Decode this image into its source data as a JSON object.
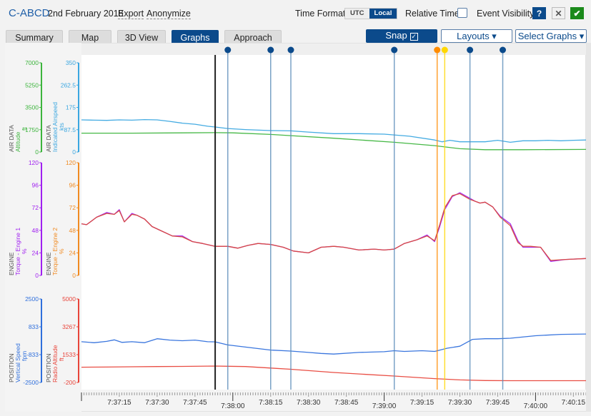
{
  "header": {
    "aircraft": "C-ABCD",
    "date": "2nd February 2018",
    "export_label": "Export",
    "anonymize_label": "Anonymize",
    "time_format_label": "Time Format",
    "time_format_options": [
      "UTC",
      "Local"
    ],
    "time_format_selected": "Local",
    "relative_time_label": "Relative Time",
    "relative_time_checked": false,
    "event_visibility_label": "Event Visibility",
    "help_icon": "?",
    "close_icon": "✕",
    "confirm_icon": "✔"
  },
  "tabs": [
    {
      "label": "Summary",
      "active": false
    },
    {
      "label": "Map",
      "active": false
    },
    {
      "label": "3D View",
      "active": false
    },
    {
      "label": "Graphs",
      "active": true
    },
    {
      "label": "Approach",
      "active": false
    }
  ],
  "toolbar": {
    "snap_label": "Snap",
    "snap_checked": true,
    "layouts_label": "Layouts ▾",
    "select_graphs_label": "Select Graphs ▾"
  },
  "colors": {
    "brand": "#0b4a8b",
    "altitude": "#3cb43c",
    "airspeed": "#3aa6e0",
    "torque1": "#a020f0",
    "torque2": "#f08a20",
    "torque_overlay": "#d94a3a",
    "vertical_speed": "#2f6fdc",
    "radio_altitude": "#e8443a",
    "cursor": "#222222",
    "event_blue": "#5a8bb8",
    "event_orange": "#ff8c00",
    "event_yellow": "#ffd700"
  },
  "chart_data": {
    "type": "line",
    "x_axis": {
      "start": "7:37:05",
      "end": "7:40:25",
      "tick_labels": [
        "7:37:15",
        "7:37:30",
        "7:37:45",
        "7:38:00",
        "7:38:15",
        "7:38:30",
        "7:38:45",
        "7:39:00",
        "7:39:15",
        "7:39:30",
        "7:39:45",
        "7:40:00",
        "7:40:15"
      ],
      "tick_seconds": [
        15,
        30,
        45,
        60,
        75,
        90,
        105,
        120,
        135,
        150,
        165,
        180,
        195
      ]
    },
    "cursor_time_s": 53,
    "events": [
      {
        "time_s": 58,
        "color": "blue"
      },
      {
        "time_s": 75,
        "color": "blue"
      },
      {
        "time_s": 83,
        "color": "blue"
      },
      {
        "time_s": 124,
        "color": "blue"
      },
      {
        "time_s": 141,
        "color": "orange"
      },
      {
        "time_s": 144,
        "color": "yellow"
      },
      {
        "time_s": 154,
        "color": "blue"
      },
      {
        "time_s": 167,
        "color": "blue"
      }
    ],
    "panels": [
      {
        "group": "AIR DATA",
        "axes": [
          {
            "name": "Altitude",
            "unit": "ft",
            "ylim": [
              0,
              7000
            ],
            "ticks": [
              "7000",
              "5250",
              "3500",
              "1750",
              "0"
            ],
            "color_key": "altitude"
          },
          {
            "name": "Indicated Airspeed",
            "unit": "kts",
            "ylim": [
              0,
              350
            ],
            "ticks": [
              "350",
              "262.5",
              "175",
              "87.5",
              "0"
            ],
            "color_key": "airspeed"
          }
        ],
        "series": [
          {
            "name": "Altitude",
            "axis": 0,
            "color_key": "altitude",
            "x": [
              0,
              20,
              40,
              53,
              60,
              75,
              83,
              100,
              124,
              140,
              150,
              160,
              175,
              200
            ],
            "y": [
              1480,
              1480,
              1500,
              1520,
              1500,
              1380,
              1280,
              1080,
              760,
              500,
              260,
              180,
              180,
              200
            ]
          },
          {
            "name": "Indicated Airspeed",
            "axis": 1,
            "color_key": "airspeed",
            "x": [
              0,
              5,
              10,
              15,
              20,
              25,
              30,
              35,
              40,
              45,
              50,
              53,
              58,
              65,
              75,
              83,
              90,
              100,
              110,
              120,
              130,
              140,
              143,
              146,
              150,
              155,
              160,
              165,
              170,
              175,
              180,
              185,
              190,
              195,
              200
            ],
            "y": [
              126,
              125,
              124,
              126,
              125,
              127,
              126,
              120,
              113,
              109,
              101,
              98,
              92,
              88,
              84,
              83,
              78,
              72,
              72,
              70,
              62,
              47,
              40,
              46,
              40,
              40,
              40,
              46,
              38,
              44,
              44,
              46,
              44,
              46,
              47
            ]
          }
        ]
      },
      {
        "group": "ENGINE",
        "axes": [
          {
            "name": "Torque - Engine 1",
            "unit": "%",
            "ylim": [
              0,
              120
            ],
            "ticks": [
              "120",
              "96",
              "72",
              "48",
              "24",
              "0"
            ],
            "color_key": "torque1"
          },
          {
            "name": "Torque - Engine 2",
            "unit": "%",
            "ylim": [
              0,
              120
            ],
            "ticks": [
              "120",
              "96",
              "72",
              "48",
              "24",
              "0"
            ],
            "color_key": "torque2"
          }
        ],
        "series": [
          {
            "name": "Torque - Engine 1",
            "axis": 0,
            "color_key": "torque1",
            "x": [
              0,
              2,
              6,
              10,
              13,
              15,
              17,
              20,
              22,
              25,
              28,
              32,
              36,
              40,
              44,
              48,
              53,
              58,
              62,
              66,
              70,
              75,
              80,
              84,
              90,
              95,
              100,
              104,
              110,
              116,
              120,
              124,
              128,
              133,
              137,
              140,
              142,
              144,
              147,
              150,
              152,
              154,
              156,
              158,
              160,
              163,
              166,
              170,
              173,
              175,
              178,
              182,
              186,
              192,
              200
            ],
            "y": [
              55,
              54,
              62,
              67,
              65,
              70,
              57,
              66,
              64,
              60,
              52,
              47,
              42,
              42,
              36,
              34,
              31,
              31,
              29,
              32,
              34,
              33,
              30,
              26,
              24,
              30,
              31,
              30,
              27,
              28,
              27,
              28,
              34,
              38,
              43,
              36,
              52,
              70,
              84,
              88,
              85,
              82,
              79,
              77,
              78,
              73,
              63,
              55,
              37,
              30,
              30,
              30,
              15,
              17,
              18
            ]
          },
          {
            "name": "Torque - Engine 2",
            "axis": 1,
            "color_key": "torque2",
            "x": [
              0,
              2,
              6,
              10,
              13,
              15,
              17,
              20,
              22,
              25,
              28,
              32,
              36,
              40,
              44,
              48,
              53,
              58,
              62,
              66,
              70,
              75,
              80,
              84,
              90,
              95,
              100,
              104,
              110,
              116,
              120,
              124,
              128,
              133,
              137,
              140,
              142,
              144,
              147,
              150,
              152,
              154,
              156,
              158,
              160,
              163,
              166,
              170,
              173,
              175,
              178,
              182,
              186,
              192,
              200
            ],
            "y": [
              55,
              54,
              62,
              66,
              65,
              69,
              57,
              65,
              64,
              60,
              52,
              47,
              42,
              41,
              36,
              34,
              31,
              31,
              29,
              32,
              34,
              33,
              30,
              26,
              24,
              30,
              31,
              30,
              27,
              28,
              27,
              28,
              34,
              38,
              42,
              37,
              54,
              72,
              85,
              87,
              84,
              81,
              79,
              77,
              78,
              73,
              62,
              53,
              35,
              31,
              31,
              30,
              16,
              17,
              18
            ]
          }
        ]
      },
      {
        "group": "POSITION",
        "axes": [
          {
            "name": "Vertical Speed",
            "unit": "fpm",
            "ylim": [
              -2500,
              2500
            ],
            "ticks": [
              "2500",
              "833",
              "-833",
              "-2500"
            ],
            "color_key": "vertical_speed"
          },
          {
            "name": "Radio Altitude",
            "unit": "ft",
            "ylim": [
              -200,
              5000
            ],
            "ticks": [
              "5000",
              "3267",
              "1533",
              "-200"
            ],
            "color_key": "radio_altitude"
          }
        ],
        "series": [
          {
            "name": "Vertical Speed",
            "axis": 0,
            "color_key": "vertical_speed",
            "x": [
              0,
              5,
              10,
              13,
              16,
              20,
              25,
              30,
              35,
              40,
              45,
              50,
              53,
              58,
              65,
              75,
              83,
              90,
              95,
              100,
              110,
              120,
              124,
              128,
              135,
              140,
              145,
              150,
              155,
              160,
              165,
              170,
              180,
              190,
              200
            ],
            "y": [
              -60,
              -120,
              -40,
              50,
              -100,
              -60,
              -120,
              120,
              40,
              0,
              40,
              -60,
              -70,
              -250,
              -380,
              -560,
              -620,
              -700,
              -760,
              -800,
              -700,
              -660,
              -600,
              -640,
              -600,
              -640,
              -450,
              -330,
              80,
              120,
              120,
              150,
              300,
              380,
              400
            ]
          },
          {
            "name": "Radio Altitude",
            "axis": 1,
            "color_key": "radio_altitude",
            "x": [
              0,
              10,
              20,
              30,
              40,
              53,
              58,
              65,
              75,
              83,
              100,
              124,
              140,
              150,
              160,
              170,
              180,
              200
            ],
            "y": [
              750,
              760,
              780,
              790,
              800,
              820,
              810,
              790,
              700,
              620,
              420,
              200,
              40,
              -40,
              -80,
              -90,
              -90,
              -90
            ]
          }
        ]
      }
    ]
  }
}
